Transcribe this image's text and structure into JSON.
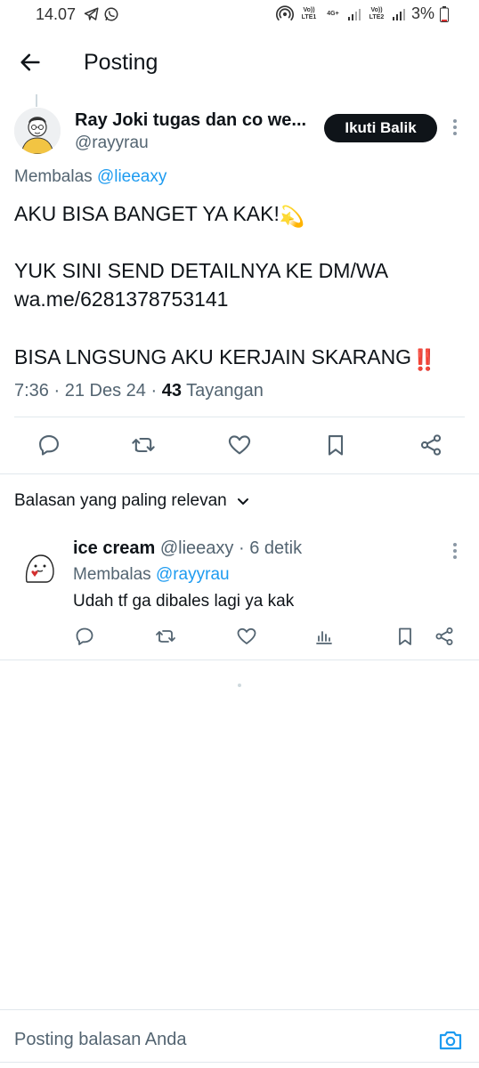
{
  "status_bar": {
    "time": "14.07",
    "battery": "3%",
    "net1": "Vo)) LTE1",
    "net_4g": "4G+",
    "net2": "Vo)) LTE2",
    "icons": [
      "telegram-icon",
      "whatsapp-icon",
      "hotspot-icon",
      "signal-icon",
      "battery-icon"
    ]
  },
  "header": {
    "title": "Posting"
  },
  "post": {
    "author_name": "Ray Joki tugas dan co we...",
    "author_handle": "@rayyrau",
    "follow_label": "Ikuti Balik",
    "reply_prefix": "Membalas",
    "reply_handle": "@lieeaxy",
    "line1": "AKU BISA BANGET YA KAK!",
    "line1_emoji": "💫",
    "line2": "YUK SINI SEND DETAILNYA KE DM/WA",
    "link": "wa.me/6281378753141",
    "line3": "BISA LNGSUNG AKU KERJAIN SKARANG",
    "line3_emoji": "‼️",
    "time": "7:36",
    "sep": "·",
    "date": "21 Des 24",
    "views_count": "43",
    "views_label": "Tayangan"
  },
  "actions": [
    "reply-icon",
    "retweet-icon",
    "like-icon",
    "bookmark-icon",
    "share-icon"
  ],
  "replies_section": {
    "sort_label": "Balasan yang paling relevan"
  },
  "reply": {
    "name": "ice cream",
    "handle": "@lieeaxy",
    "time": "· 6 detik",
    "reply_prefix": "Membalas",
    "reply_handle": "@rayyrau",
    "text": "Udah tf ga dibales lagi ya kak"
  },
  "compose": {
    "placeholder": "Posting balasan Anda"
  },
  "colors": {
    "accent": "#1d9bf0",
    "text": "#0f1419",
    "secondary": "#536471",
    "follow_bg": "#0f1419",
    "divider": "#e1e8ed"
  }
}
